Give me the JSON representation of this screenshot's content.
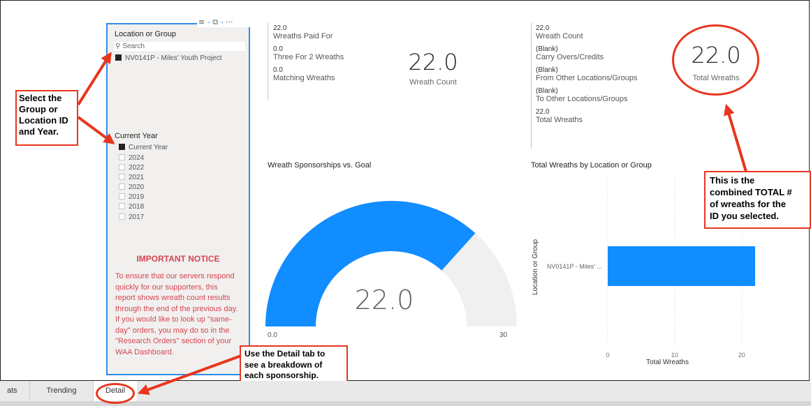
{
  "slicer": {
    "location_title": "Location or Group",
    "search_placeholder": "Search",
    "location_items": [
      "NV0141P - Miles' Youth Project"
    ],
    "year_title": "Current Year",
    "year_items": [
      "Current Year",
      "2024",
      "2022",
      "2021",
      "2020",
      "2019",
      "2018",
      "2017"
    ],
    "header_icons": "≣ · ⧉ · ···"
  },
  "notice": {
    "title": "IMPORTANT NOTICE",
    "lines": [
      "To ensure that our servers respond",
      "quickly for our supporters, this",
      "report shows wreath count results",
      "through the end of the previous day.",
      "If you would like to look up \"same-",
      "day\" orders, you may do so in the",
      "\"Research Orders\" section of your",
      "WAA Dashboard."
    ]
  },
  "card_left": {
    "rows": [
      {
        "value": "22.0",
        "label": "Wreaths Paid For"
      },
      {
        "value": "0.0",
        "label": "Three For 2 Wreaths"
      },
      {
        "value": "0.0",
        "label": "Matching Wreaths"
      }
    ],
    "big_value": "22.0",
    "big_label": "Wreath Count"
  },
  "card_right": {
    "rows": [
      {
        "value": "22.0",
        "label": "Wreath Count"
      },
      {
        "value": "(Blank)",
        "label": "Carry Overs/Credits"
      },
      {
        "value": "(Blank)",
        "label": "From Other Locations/Groups"
      },
      {
        "value": "(Blank)",
        "label": "To Other Locations/Groups"
      },
      {
        "value": "22.0",
        "label": "Total Wreaths"
      }
    ],
    "big_value": "22.0",
    "big_label": "Total Wreaths"
  },
  "gauge": {
    "title": "Wreath Sponsorships vs. Goal",
    "value_label": "22.0",
    "min_label": "0.0",
    "max_label": "30",
    "fill_fraction": 0.7333,
    "colors": {
      "fill": "#118dff",
      "track": "#f0f0f0"
    }
  },
  "chart_data": {
    "type": "bar",
    "title": "Total Wreaths by Location or Group",
    "categories": [
      "NV0141P - Miles' ..."
    ],
    "values": [
      22
    ],
    "xlabel": "Total Wreaths",
    "ylabel": "Location or Group",
    "xticks": [
      "0",
      "10",
      "20"
    ],
    "xlim": [
      0,
      22
    ],
    "grid": true,
    "color": "#118dff"
  },
  "callouts": {
    "select": [
      "Select the",
      "Group or",
      "Location ID",
      "and Year."
    ],
    "total": [
      "This is the",
      "combined TOTAL #",
      "of wreaths for the",
      "ID you selected."
    ],
    "detail": [
      "Use the Detail tab to",
      "see a breakdown of",
      "each sponsorship."
    ]
  },
  "tabs": [
    "ats",
    "Trending",
    "Detail"
  ],
  "colors": {
    "accent_red": "#e8361e",
    "notice_red": "#d64550",
    "panel_border": "#2f8be6"
  }
}
